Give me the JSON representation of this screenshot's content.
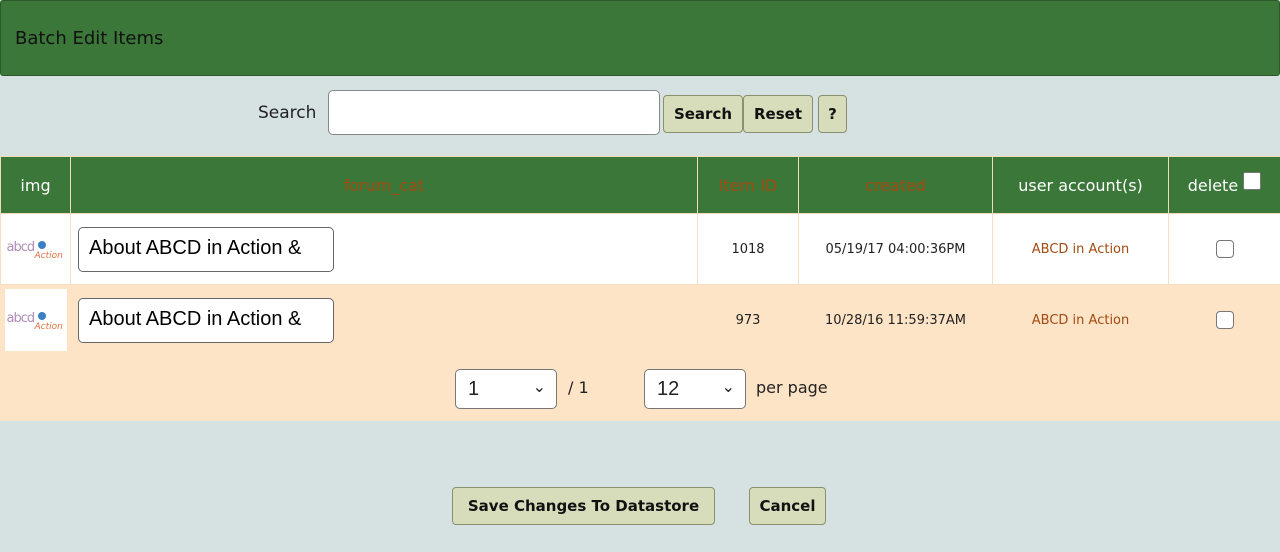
{
  "title": "Batch Edit Items",
  "search": {
    "label": "Search",
    "value": "",
    "search_btn": "Search",
    "reset_btn": "Reset",
    "help_btn": "?"
  },
  "columns": [
    "img",
    "forum_cat",
    "Item ID",
    "created",
    "user account(s)",
    "delete"
  ],
  "rows": [
    {
      "forum_cat": "About ABCD in Action &",
      "item_id": "1018",
      "created": "05/19/17 04:00:36PM",
      "user": "ABCD in Action",
      "delete": false
    },
    {
      "forum_cat": "About ABCD in Action &",
      "item_id": "973",
      "created": "10/28/16 11:59:37AM",
      "user": "ABCD in Action",
      "delete": false
    }
  ],
  "logo_text": {
    "a": "abcd",
    "b": "Action"
  },
  "pagination": {
    "page": "1",
    "of": "/ 1",
    "per_page": "12",
    "per_page_label": "per page"
  },
  "actions": {
    "save": "Save Changes To Datastore",
    "cancel": "Cancel"
  }
}
